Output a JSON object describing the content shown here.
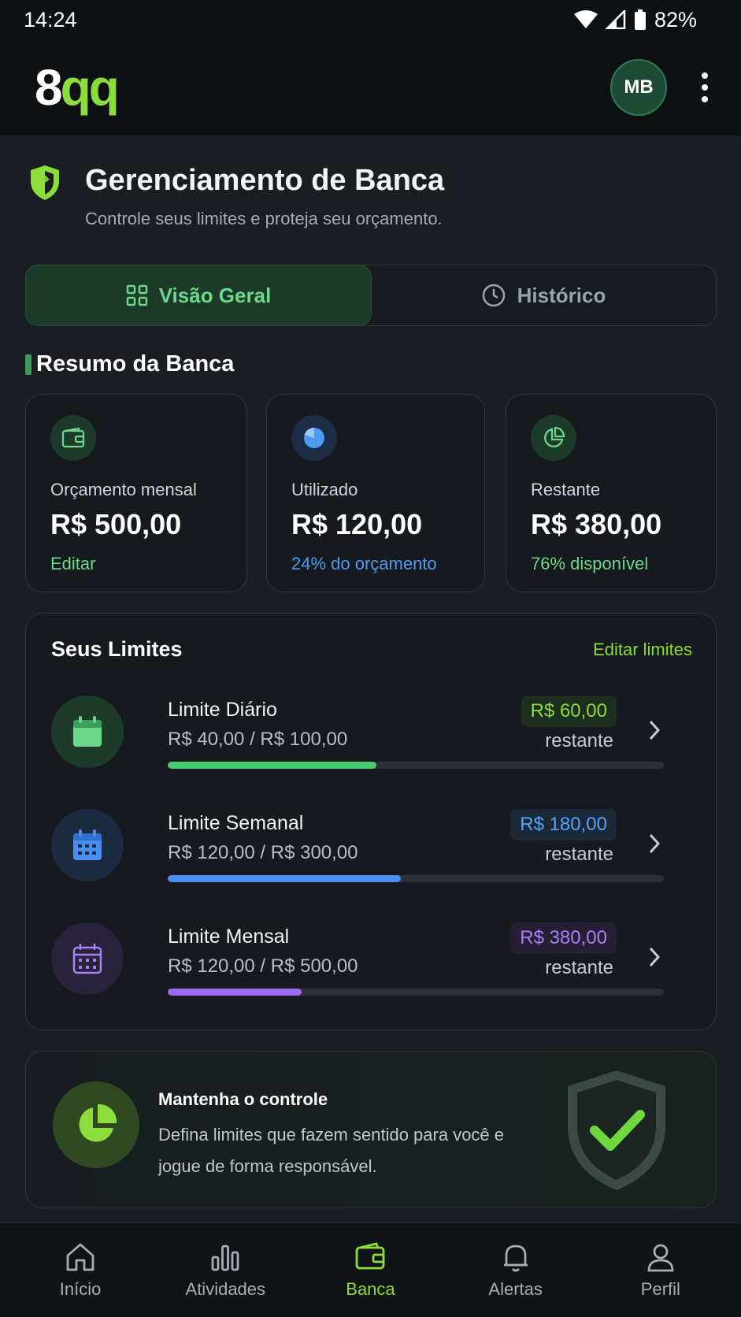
{
  "status_bar": {
    "time": "14:24",
    "battery": "82%"
  },
  "header": {
    "logo_main": "8",
    "logo_accent": "qq",
    "avatar_initials": "MB"
  },
  "page": {
    "title": "Gerenciamento de Banca",
    "subtitle": "Controle seus limites e proteja seu orçamento."
  },
  "tabs": [
    {
      "label": "Visão Geral",
      "icon": "grid-icon",
      "active": true
    },
    {
      "label": "Histórico",
      "icon": "clock-icon",
      "active": false
    }
  ],
  "summary": {
    "title": "Resumo da Banca",
    "cards": [
      {
        "label": "Orçamento mensal",
        "value": "R$ 500,00",
        "note": "Editar",
        "color": "#6ed88a",
        "icon": "wallet-icon"
      },
      {
        "label": "Utilizado",
        "value": "R$ 120,00",
        "note": "24% do orçamento",
        "color": "#4c9cf0",
        "icon": "pie-chart-icon"
      },
      {
        "label": "Restante",
        "value": "R$ 380,00",
        "note": "76% disponível",
        "color": "#6ed88a",
        "icon": "pie-chart-outline-icon"
      }
    ]
  },
  "limits": {
    "title": "Seus Limites",
    "edit_label": "Editar limites",
    "items": [
      {
        "name": "Limite Diário",
        "usage": "R$ 40,00 / R$ 100,00",
        "badge": "R$ 60,00",
        "remaining_label": "restante",
        "progress": 0.42,
        "color": "#4cc872",
        "badge_text_color": "#8cdc3c",
        "icon": "calendar-icon"
      },
      {
        "name": "Limite Semanal",
        "usage": "R$ 120,00 / R$ 300,00",
        "badge": "R$ 180,00",
        "remaining_label": "restante",
        "progress": 0.47,
        "color": "#4c8ef0",
        "badge_text_color": "#5aa4f5",
        "icon": "calendar-week-icon"
      },
      {
        "name": "Limite Mensal",
        "usage": "R$ 120,00 / R$ 500,00",
        "badge": "R$ 380,00",
        "remaining_label": "restante",
        "progress": 0.27,
        "color": "#9c6cf0",
        "badge_text_color": "#a880f5",
        "icon": "calendar-month-icon"
      }
    ]
  },
  "promo": {
    "title": "Mantenha o controle",
    "text": "Defina limites que fazem sentido para você e jogue de forma responsável."
  },
  "nav": [
    {
      "label": "Início",
      "icon": "home-icon",
      "active": false
    },
    {
      "label": "Atividades",
      "icon": "bar-chart-icon",
      "active": false
    },
    {
      "label": "Banca",
      "icon": "wallet-icon",
      "active": true
    },
    {
      "label": "Alertas",
      "icon": "bell-icon",
      "active": false
    },
    {
      "label": "Perfil",
      "icon": "user-icon",
      "active": false
    }
  ]
}
